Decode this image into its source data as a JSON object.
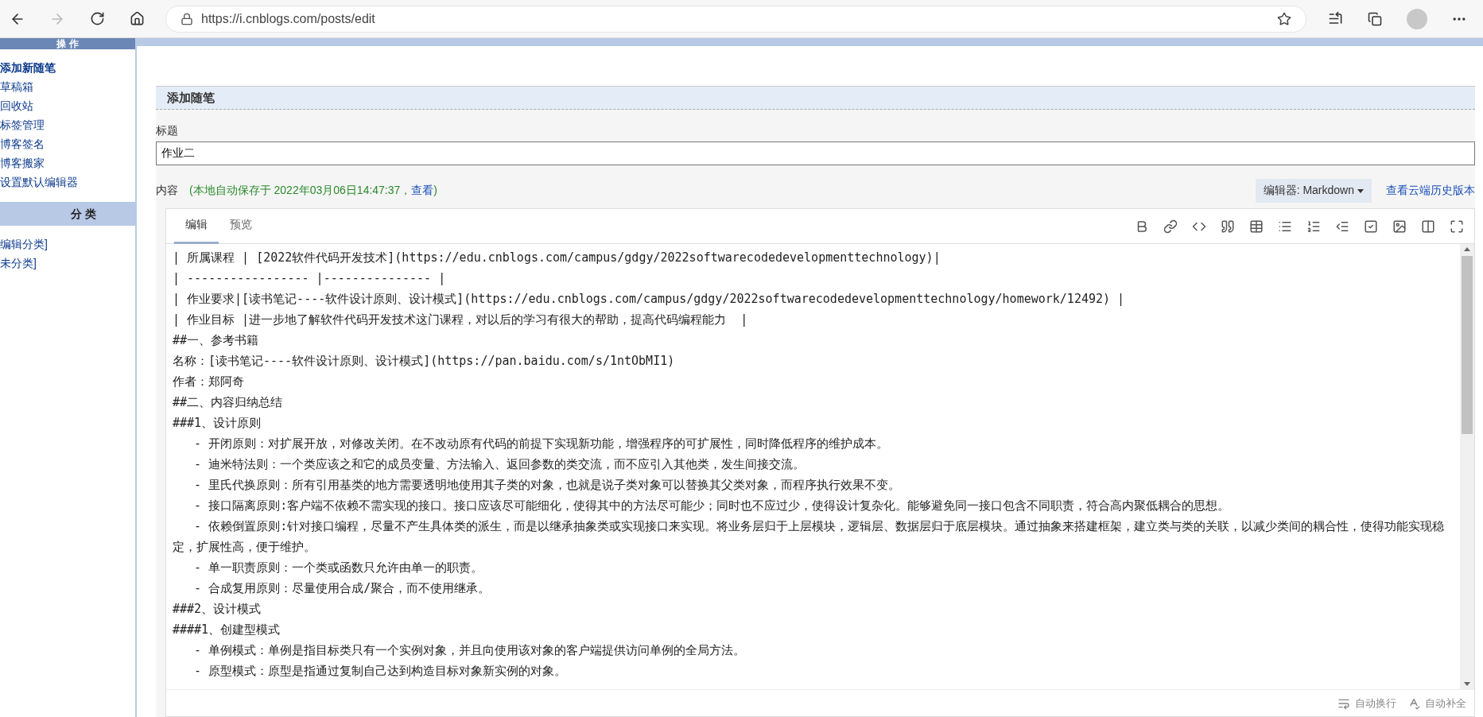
{
  "browser": {
    "url": "https://i.cnblogs.com/posts/edit",
    "forward_disabled": true
  },
  "sidebar": {
    "header": "操 作",
    "items": [
      {
        "label": "添加新随笔",
        "selected": true
      },
      {
        "label": "草稿箱",
        "selected": false
      },
      {
        "label": "回收站",
        "selected": false
      },
      {
        "label": "标签管理",
        "selected": false
      },
      {
        "label": "博客签名",
        "selected": false
      },
      {
        "label": "博客搬家",
        "selected": false
      },
      {
        "label": "设置默认编辑器",
        "selected": false
      }
    ],
    "category_header": "分 类",
    "categories": [
      "编辑分类]",
      "未分类]"
    ]
  },
  "form": {
    "heading": "添加随笔",
    "title_label": "标题",
    "title_value": "作业二",
    "content_label": "内容",
    "autosave": {
      "text": "(本地自动保存于 2022年03月06日14:47:37，",
      "link": "查看",
      "close": ")"
    },
    "editor_select": "编辑器: Markdown",
    "history_link": "查看云端历史版本"
  },
  "editor": {
    "tabs": [
      {
        "label": "编辑",
        "selected": true
      },
      {
        "label": "预览",
        "selected": false
      }
    ],
    "lines": [
      "| 所属课程 | [2022软件代码开发技术](https://edu.cnblogs.com/campus/gdgy/2022softwarecodedevelopmenttechnology)|",
      "| ----------------- |--------------- |",
      "| 作业要求|[读书笔记----软件设计原则、设计模式](https://edu.cnblogs.com/campus/gdgy/2022softwarecodedevelopmenttechnology/homework/12492) |",
      "| 作业目标 |进一步地了解软件代码开发技术这门课程，对以后的学习有很大的帮助，提高代码编程能力  |",
      "##一、参考书籍",
      "名称：[读书笔记----软件设计原则、设计模式](https://pan.baidu.com/s/1ntObMI1)",
      "作者：郑阿奇",
      "##二、内容归纳总结",
      "###1、设计原则",
      "   - 开闭原则：对扩展开放，对修改关闭。在不改动原有代码的前提下实现新功能，增强程序的可扩展性，同时降低程序的维护成本。",
      "   - 迪米特法则：一个类应该之和它的成员变量、方法输入、返回参数的类交流，而不应引入其他类，发生间接交流。",
      "   - 里氏代换原则：所有引用基类的地方需要透明地使用其子类的对象，也就是说子类对象可以替换其父类对象，而程序执行效果不变。",
      "   - 接口隔离原则:客户端不依赖不需实现的接口。接口应该尽可能细化，使得其中的方法尽可能少；同时也不应过少，使得设计复杂化。能够避免同一接口包含不同职责，符合高内聚低耦合的思想。",
      "   - 依赖倒置原则:针对接口编程，尽量不产生具体类的派生，而是以继承抽象类或实现接口来实现。将业务层归于上层模块，逻辑层、数据层归于底层模块。通过抽象来搭建框架，建立类与类的关联，以减少类间的耦合性，使得功能实现稳定，扩展性高，便于维护。",
      "   - 单一职责原则：一个类或函数只允许由单一的职责。",
      "   - 合成复用原则：尽量使用合成/聚合，而不使用继承。",
      "###2、设计模式",
      "####1、创建型模式",
      "   - 单例模式：单例是指目标类只有一个实例对象，并且向使用该对象的客户端提供访问单例的全局方法。",
      "   - 原型模式：原型是指通过复制自己达到构造目标对象新实例的对象。"
    ],
    "status": [
      "自动换行",
      "自动补全"
    ]
  }
}
